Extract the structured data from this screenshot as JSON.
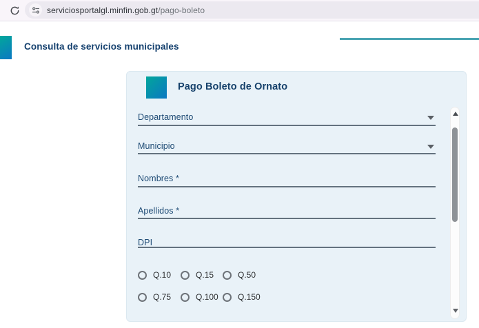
{
  "browser": {
    "url_domain": "serviciosportalgl.minfin.gob.gt",
    "url_path": "/pago-boleto"
  },
  "header": {
    "title": "Consulta de servicios municipales"
  },
  "card": {
    "title": "Pago Boleto de Ornato",
    "fields": [
      {
        "label": "Departamento",
        "type": "select",
        "value": ""
      },
      {
        "label": "Municipio",
        "type": "select",
        "value": ""
      },
      {
        "label": "Nombres *",
        "type": "text",
        "value": ""
      },
      {
        "label": "Apellidos *",
        "type": "text",
        "value": ""
      },
      {
        "label": "DPI",
        "type": "text",
        "value": ""
      }
    ],
    "amount_options": [
      "Q.10",
      "Q.15",
      "Q.50",
      "Q.75",
      "Q.100",
      "Q.150"
    ]
  },
  "icons": {
    "reload": "reload-icon",
    "site_info": "tune-icon",
    "select_caret": "chevron-down-icon",
    "scroll_up": "arrow-up-icon",
    "scroll_down": "arrow-down-icon"
  },
  "colors": {
    "accent_gradient_start": "#02a79b",
    "accent_gradient_end": "#0b78c3",
    "teal_rule": "#4aa4b3",
    "card_background": "#e9f2f8",
    "field_label": "#1d4a74",
    "title_navy": "#14406e"
  }
}
